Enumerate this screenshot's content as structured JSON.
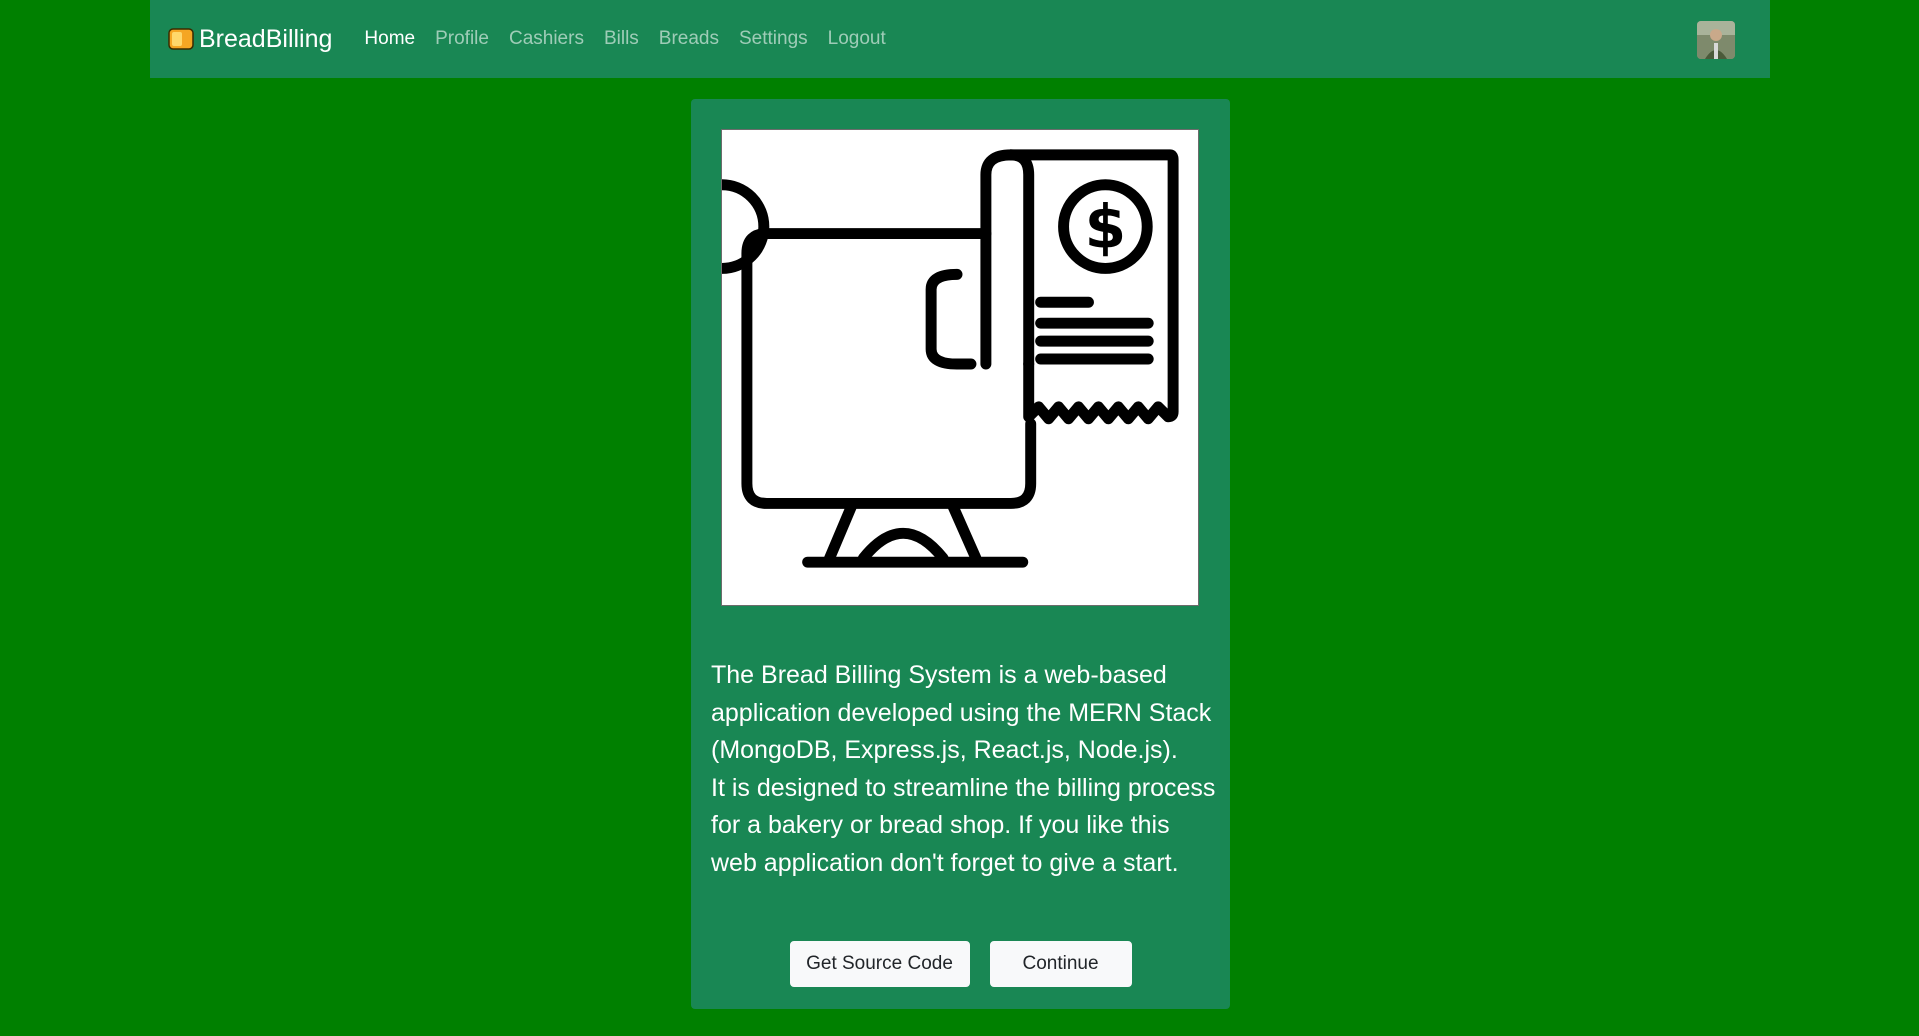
{
  "navbar": {
    "brand": "BreadBilling",
    "brand_icon": "bread-icon",
    "links": [
      {
        "label": "Home",
        "active": true
      },
      {
        "label": "Profile",
        "active": false
      },
      {
        "label": "Cashiers",
        "active": false
      },
      {
        "label": "Bills",
        "active": false
      },
      {
        "label": "Breads",
        "active": false
      },
      {
        "label": "Settings",
        "active": false
      },
      {
        "label": "Logout",
        "active": false
      }
    ],
    "avatar": "user-avatar"
  },
  "hero": {
    "illustration": "billing-monitor-receipt-icon",
    "description_line1": "The Bread Billing System is a web-based application developed using the MERN Stack (MongoDB, Express.js, React.js, Node.js).",
    "description_line2": "It is designed to streamline the billing process for a bakery or bread shop. If you like this web application don't forget to give a start.",
    "buttons": {
      "source_label": "Get Source Code",
      "continue_label": "Continue"
    }
  },
  "colors": {
    "page_background": "#008000",
    "navbar_background": "#198754",
    "card_background": "#198754",
    "button_background": "#f8f9fa"
  }
}
